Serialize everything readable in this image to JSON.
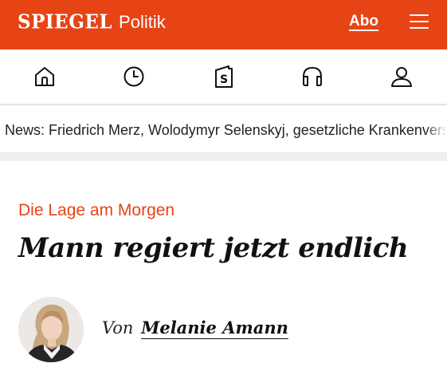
{
  "header": {
    "logo": "SPIEGEL",
    "section": "Politik",
    "abo_label": "Abo",
    "menu_icon": "hamburger-menu-icon",
    "background_color": "#e64415"
  },
  "nav": {
    "items": [
      {
        "icon": "home-icon"
      },
      {
        "icon": "clock-icon"
      },
      {
        "icon": "spiegel-s-icon"
      },
      {
        "icon": "headphones-icon"
      },
      {
        "icon": "user-icon"
      }
    ]
  },
  "ticker": {
    "text": "News: Friedrich Merz, Wolodymyr Selenskyj, gesetzliche Krankenversicherung"
  },
  "article": {
    "kicker": "Die Lage am Morgen",
    "headline": "Mann regiert jetzt endlich",
    "byline_prefix": "Von",
    "author": "Melanie Amann",
    "kicker_color": "#e64415"
  }
}
